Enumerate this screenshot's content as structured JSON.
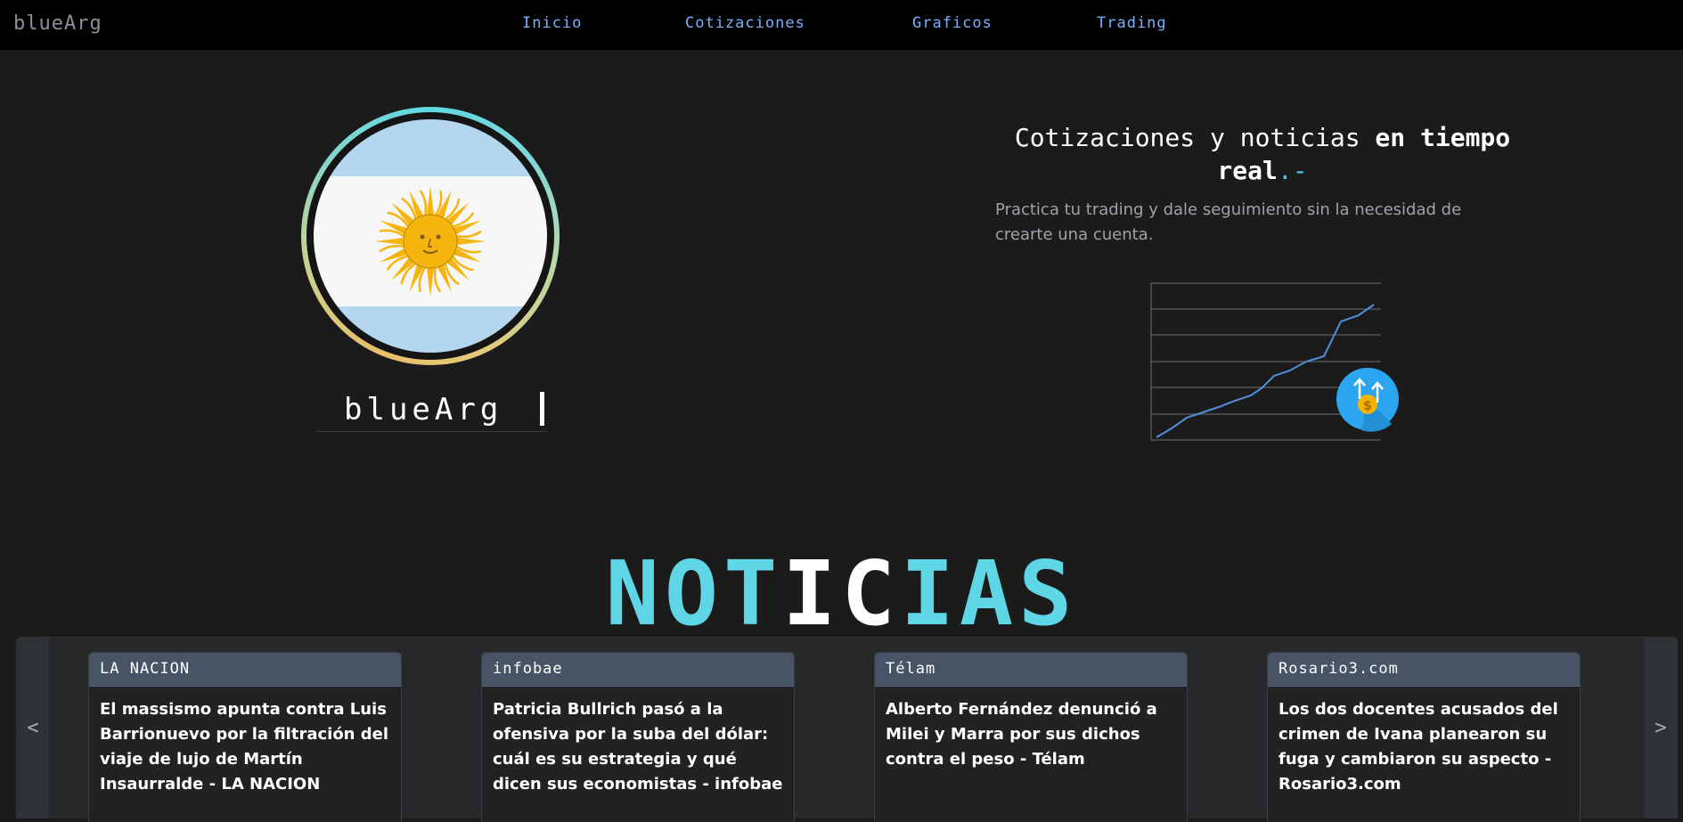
{
  "nav": {
    "brand": "blueArg",
    "links": [
      "Inicio",
      "Cotizaciones",
      "Graficos",
      "Trading"
    ]
  },
  "hero": {
    "name": "blueArg",
    "headline_plain": "Cotizaciones y noticias ",
    "headline_bold": "en tiempo real",
    "headline_accent": ".-",
    "subtitle": "Practica tu trading y dale seguimiento sin la necesidad de crearte una cuenta.",
    "currency_icon_symbol": "$"
  },
  "news": {
    "title": "NOTICIAS",
    "prev_label": "<",
    "next_label": ">",
    "cards": [
      {
        "source": "LA NACION",
        "headline": "El massismo apunta contra Luis Barrionuevo por la filtración del viaje de lujo de Martín Insaurralde - LA NACION"
      },
      {
        "source": "infobae",
        "headline": "Patricia Bullrich pasó a la ofensiva por la suba del dólar: cuál es su estrategia y qué dicen sus economistas - infobae"
      },
      {
        "source": "Télam",
        "headline": "Alberto Fernández denunció a Milei y Marra por sus dichos contra el peso - Télam"
      },
      {
        "source": "Rosario3.com",
        "headline": "Los dos docentes acusados del crimen de Ivana planearon su fuga y cambiaron su aspecto - Rosario3.com"
      }
    ]
  },
  "colors": {
    "accent": "#5fd6e6",
    "nav_link": "#7ab0ff",
    "card_header": "#475466"
  }
}
